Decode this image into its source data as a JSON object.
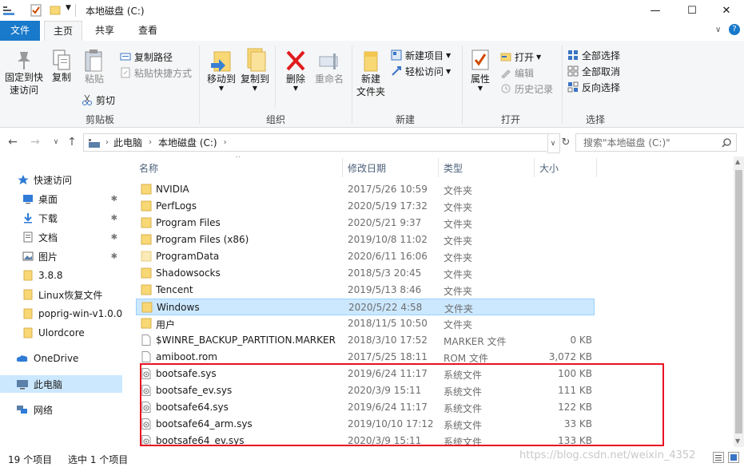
{
  "window": {
    "title": "本地磁盘 (C:)",
    "minimize": "—",
    "maximize": "☐",
    "close": "✕"
  },
  "tabs": {
    "file": "文件",
    "home": "主页",
    "share": "共享",
    "view": "查看"
  },
  "ribbon": {
    "clipboard": {
      "group": "剪贴板",
      "pin": "固定到快速访问",
      "pin_l1": "固定到快",
      "pin_l2": "速访问",
      "copy": "复制",
      "paste": "粘贴",
      "copy_path": "复制路径",
      "paste_shortcut": "粘贴快捷方式",
      "cut": "剪切"
    },
    "organize": {
      "group": "组织",
      "move_to": "移动到",
      "copy_to": "复制到",
      "delete": "删除",
      "rename": "重命名"
    },
    "new": {
      "group": "新建",
      "new_folder_l1": "新建",
      "new_folder_l2": "文件夹",
      "new_item": "新建项目",
      "easy_access": "轻松访问"
    },
    "open": {
      "group": "打开",
      "properties": "属性",
      "open": "打开",
      "edit": "编辑",
      "history": "历史记录"
    },
    "select": {
      "group": "选择",
      "select_all": "全部选择",
      "select_none": "全部取消",
      "invert": "反向选择"
    }
  },
  "address": {
    "pc": "此电脑",
    "drive": "本地磁盘 (C:)",
    "search_placeholder": "搜索\"本地磁盘 (C:)\""
  },
  "nav": [
    {
      "label": "快速访问",
      "icon": "star-icon"
    },
    {
      "label": "桌面",
      "icon": "desktop-icon",
      "pinned": true
    },
    {
      "label": "下载",
      "icon": "download-icon",
      "pinned": true
    },
    {
      "label": "文档",
      "icon": "document-icon",
      "pinned": true
    },
    {
      "label": "图片",
      "icon": "picture-icon",
      "pinned": true
    },
    {
      "label": "3.8.8",
      "icon": "folder-icon"
    },
    {
      "label": "Linux恢复文件",
      "icon": "folder-icon"
    },
    {
      "label": "poprig-win-v1.0.0",
      "icon": "folder-icon"
    },
    {
      "label": "Ulordcore",
      "icon": "folder-icon"
    },
    {
      "label": "OneDrive",
      "icon": "cloud-icon"
    },
    {
      "label": "此电脑",
      "icon": "computer-icon"
    },
    {
      "label": "网络",
      "icon": "network-icon"
    }
  ],
  "columns": {
    "name": "名称",
    "modified": "修改日期",
    "type": "类型",
    "size": "大小"
  },
  "files": [
    {
      "name": "NVIDIA",
      "modified": "2017/5/26 10:59",
      "type": "文件夹",
      "size": "",
      "kind": "folder"
    },
    {
      "name": "PerfLogs",
      "modified": "2020/5/19 17:32",
      "type": "文件夹",
      "size": "",
      "kind": "folder"
    },
    {
      "name": "Program Files",
      "modified": "2020/5/21 9:37",
      "type": "文件夹",
      "size": "",
      "kind": "folder"
    },
    {
      "name": "Program Files (x86)",
      "modified": "2019/10/8 11:02",
      "type": "文件夹",
      "size": "",
      "kind": "folder"
    },
    {
      "name": "ProgramData",
      "modified": "2020/6/11 16:06",
      "type": "文件夹",
      "size": "",
      "kind": "folder-light"
    },
    {
      "name": "Shadowsocks",
      "modified": "2018/5/3 20:45",
      "type": "文件夹",
      "size": "",
      "kind": "folder"
    },
    {
      "name": "Tencent",
      "modified": "2019/5/13 8:46",
      "type": "文件夹",
      "size": "",
      "kind": "folder"
    },
    {
      "name": "Windows",
      "modified": "2020/5/22 4:58",
      "type": "文件夹",
      "size": "",
      "kind": "folder"
    },
    {
      "name": "用户",
      "modified": "2018/11/5 10:50",
      "type": "文件夹",
      "size": "",
      "kind": "folder"
    },
    {
      "name": "$WINRE_BACKUP_PARTITION.MARKER",
      "modified": "2018/3/10 17:52",
      "type": "MARKER 文件",
      "size": "0 KB",
      "kind": "file"
    },
    {
      "name": "amiboot.rom",
      "modified": "2017/5/25 18:11",
      "type": "ROM 文件",
      "size": "3,072 KB",
      "kind": "file"
    },
    {
      "name": "bootsafe.sys",
      "modified": "2019/6/24 11:17",
      "type": "系统文件",
      "size": "100 KB",
      "kind": "sys"
    },
    {
      "name": "bootsafe_ev.sys",
      "modified": "2020/3/9 15:11",
      "type": "系统文件",
      "size": "111 KB",
      "kind": "sys"
    },
    {
      "name": "bootsafe64.sys",
      "modified": "2019/6/24 11:17",
      "type": "系统文件",
      "size": "122 KB",
      "kind": "sys"
    },
    {
      "name": "bootsafe64_arm.sys",
      "modified": "2019/10/10 17:12",
      "type": "系统文件",
      "size": "33 KB",
      "kind": "sys"
    },
    {
      "name": "bootsafe64_ev.sys",
      "modified": "2020/3/9 15:11",
      "type": "系统文件",
      "size": "133 KB",
      "kind": "sys"
    }
  ],
  "selected_index": 7,
  "status": {
    "count": "19 个项目",
    "selected": "选中 1 个项目"
  },
  "watermark": "https://blog.csdn.net/weixin_4352",
  "colors": {
    "accent": "#1979ca",
    "selection": "#cce8ff",
    "highlight_box": "#e81123",
    "folder": "#f8d775"
  }
}
